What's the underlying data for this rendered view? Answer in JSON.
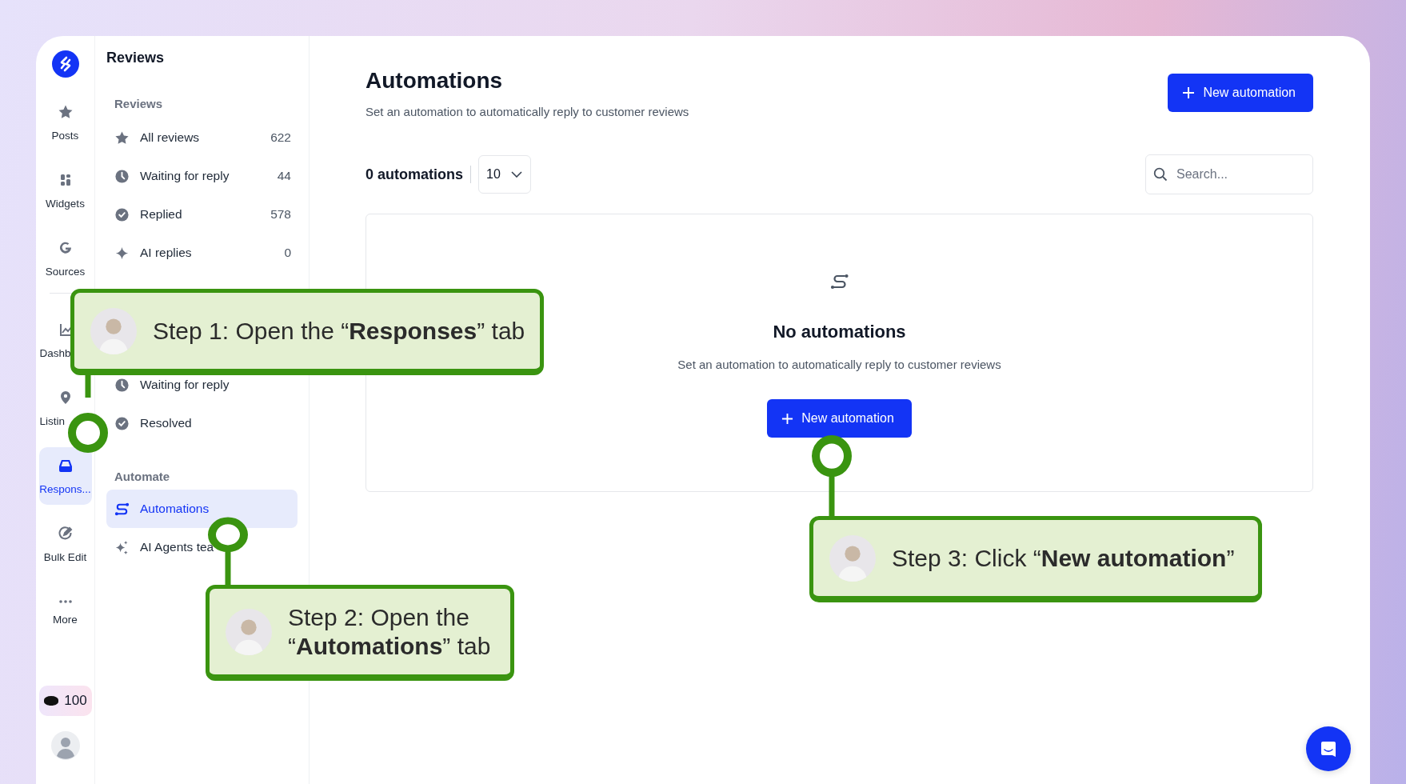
{
  "rail": {
    "items": [
      {
        "label": "Posts",
        "kind": "posts",
        "selected": false
      },
      {
        "label": "Widgets",
        "kind": "widgets",
        "selected": false
      },
      {
        "label": "Sources",
        "kind": "sources",
        "selected": false
      },
      {
        "label": "Dashb",
        "kind": "dashboard",
        "selected": false
      },
      {
        "label": "Listin",
        "kind": "listings",
        "selected": false
      },
      {
        "label": "Respons...",
        "kind": "responses",
        "selected": true
      },
      {
        "label": "Bulk Edit",
        "kind": "bulk",
        "selected": false
      },
      {
        "label": "More",
        "kind": "more",
        "selected": false
      }
    ],
    "credits": "100"
  },
  "sidebar": {
    "title": "Reviews",
    "sections": [
      {
        "heading": "Reviews",
        "items": [
          {
            "label": "All reviews",
            "count": "622",
            "kind": "all",
            "selected": false
          },
          {
            "label": "Waiting for reply",
            "count": "44",
            "kind": "pending",
            "selected": false
          },
          {
            "label": "Replied",
            "count": "578",
            "kind": "done",
            "selected": false
          },
          {
            "label": "AI replies",
            "count": "0",
            "kind": "ai",
            "selected": false
          }
        ]
      },
      {
        "items": [
          {
            "label": "Waiting for reply",
            "kind": "pending",
            "selected": false
          },
          {
            "label": "Resolved",
            "kind": "done",
            "selected": false
          }
        ]
      },
      {
        "heading": "Automate",
        "items": [
          {
            "label": "Automations",
            "kind": "flows",
            "selected": true
          },
          {
            "label": "AI Agents tea",
            "kind": "agents",
            "selected": false
          }
        ]
      }
    ]
  },
  "main": {
    "title": "Automations",
    "subtitle": "Set an automation to automatically reply to customer reviews",
    "new_button": "New automation",
    "count": "0 automations",
    "page_size": "10",
    "search": {
      "placeholder": "Search..."
    },
    "empty": {
      "title": "No automations",
      "text": "Set an automation to automatically reply to customer reviews",
      "button": "New automation"
    }
  },
  "callouts": [
    {
      "text": "Step 1: Open the “**Responses**” tab"
    },
    {
      "text": "Step 2: Open the “**Automations**” tab"
    },
    {
      "text": "Step 3: Click “**New automation**”"
    }
  ]
}
